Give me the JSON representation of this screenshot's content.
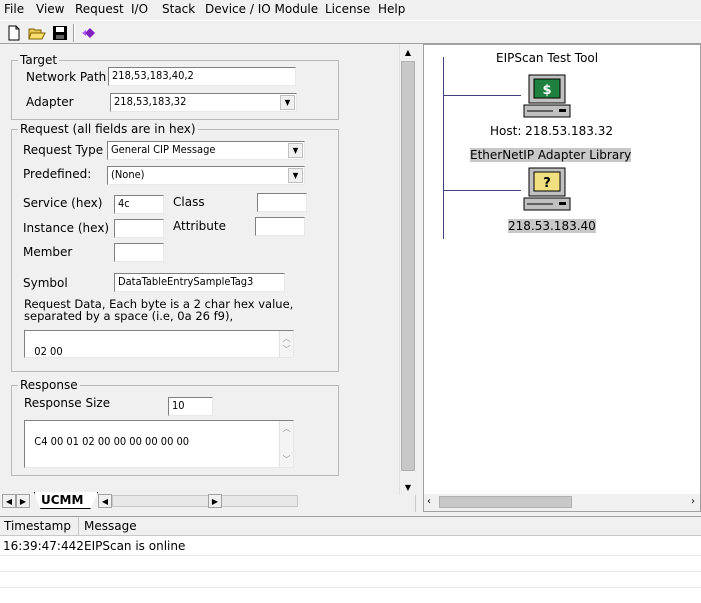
{
  "menu": [
    "File",
    "View",
    "Request",
    "I/O",
    "Stack",
    "Device / IO Module",
    "License",
    "Help"
  ],
  "toolbar": {
    "icons": [
      "new-file-icon",
      "open-folder-icon",
      "save-disk-icon",
      "diamond-icon"
    ]
  },
  "target": {
    "legend": "Target",
    "network_path_label": "Network Path",
    "network_path_value": "218,53,183,40,2",
    "adapter_label": "Adapter",
    "adapter_value": "218,53,183,32"
  },
  "request": {
    "legend": "Request (all fields are in hex)",
    "request_type_label": "Request Type",
    "request_type_value": "General CIP Message",
    "predefined_label": "Predefined:",
    "predefined_value": "(None)",
    "service_label": "Service (hex)",
    "service_value": "4c",
    "class_label": "Class",
    "class_value": "",
    "instance_label": "Instance (hex)",
    "instance_value": "",
    "attribute_label": "Attribute",
    "attribute_value": "",
    "member_label": "Member",
    "member_value": "",
    "symbol_label": "Symbol",
    "symbol_value": "DataTableEntrySampleTag3",
    "data_note_line1": "Request Data, Each byte is a 2 char hex value,",
    "data_note_line2": "separated by a space (i.e, 0a 26 f9),",
    "data_value": "02 00"
  },
  "response": {
    "legend": "Response",
    "size_label": "Response Size",
    "size_value": "10",
    "data_value": "C4 00 01 02 00 00 00 00 00 00"
  },
  "tabs": {
    "active": "UCMM"
  },
  "tree": {
    "root_title": "EIPScan Test Tool",
    "host_label": "Host: 218.53.183.32",
    "adapter_title": "EtherNetIP Adapter Library",
    "adapter_ip": "218.53.183.40"
  },
  "log": {
    "columns": [
      "Timestamp",
      "Message"
    ],
    "rows": [
      {
        "timestamp": "16:39:47:442",
        "message": "EIPScan is online"
      }
    ]
  }
}
